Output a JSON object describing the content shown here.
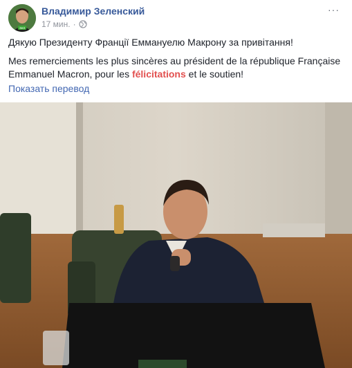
{
  "post": {
    "author": "Владимир Зеленский",
    "time": "17 мин.",
    "separator": "·",
    "more": "···",
    "line1": "Дякую Президенту Франції Еммануелю Макрону за привітання!",
    "line2_before": "Mes remerciements les plus sincères au président de la république Française Emmanuel Macron, pour les ",
    "line2_highlight": "félicitations",
    "line2_after": " et le soutien!",
    "translate": "Показать перевод"
  },
  "icons": {
    "audience": "globe-icon",
    "avatar_badge": "ЗеЗ"
  },
  "colors": {
    "link": "#365899",
    "highlight": "#e2504f",
    "translate": "#4267b2"
  }
}
